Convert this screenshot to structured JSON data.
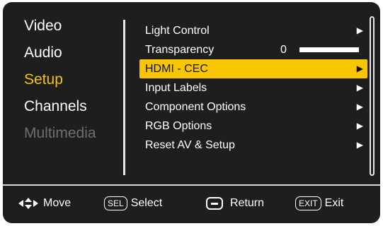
{
  "left_menu": {
    "items": [
      {
        "label": "Video",
        "state": "normal"
      },
      {
        "label": "Audio",
        "state": "normal"
      },
      {
        "label": "Setup",
        "state": "selected"
      },
      {
        "label": "Channels",
        "state": "normal"
      },
      {
        "label": "Multimedia",
        "state": "disabled"
      }
    ]
  },
  "right_menu": {
    "items": [
      {
        "label": "Light Control",
        "arrow": "▶"
      },
      {
        "label": "Transparency",
        "value": "0",
        "level_percent": 0
      },
      {
        "label": "HDMI - CEC",
        "arrow": "▶",
        "selected": true
      },
      {
        "label": "Input Labels",
        "arrow": "▶"
      },
      {
        "label": "Component Options",
        "arrow": "▶"
      },
      {
        "label": "RGB Options",
        "arrow": "▶"
      },
      {
        "label": "Reset AV & Setup",
        "arrow": "▶"
      }
    ]
  },
  "footer": {
    "move_label": "Move",
    "sel_key": "SEL",
    "select_label": "Select",
    "return_label": "Return",
    "exit_key": "EXIT",
    "exit_label": "Exit"
  },
  "colors": {
    "background": "#1e1e1e",
    "highlight": "#f7c600",
    "selected_text": "#f5c400",
    "disabled_text": "#6f6f6f"
  }
}
